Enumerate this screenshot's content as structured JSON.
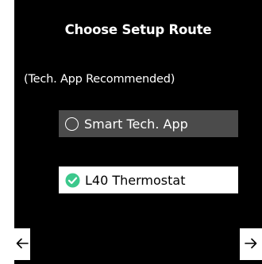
{
  "screen": {
    "title": "Choose Setup Route",
    "subtitle": "(Tech. App Recommended)"
  },
  "options": [
    {
      "label": "Smart Tech. App",
      "selected": false,
      "icon": "radio-unselected-icon"
    },
    {
      "label": "L40 Thermostat",
      "selected": true,
      "icon": "check-circle-icon"
    }
  ],
  "navigation": {
    "back_icon": "arrow-left-icon",
    "next_icon": "arrow-right-icon"
  },
  "colors": {
    "background": "#000000",
    "unselected_option": "#4b4b4b",
    "selected_option": "#ffffff",
    "check_accent": "#3cc88c"
  }
}
